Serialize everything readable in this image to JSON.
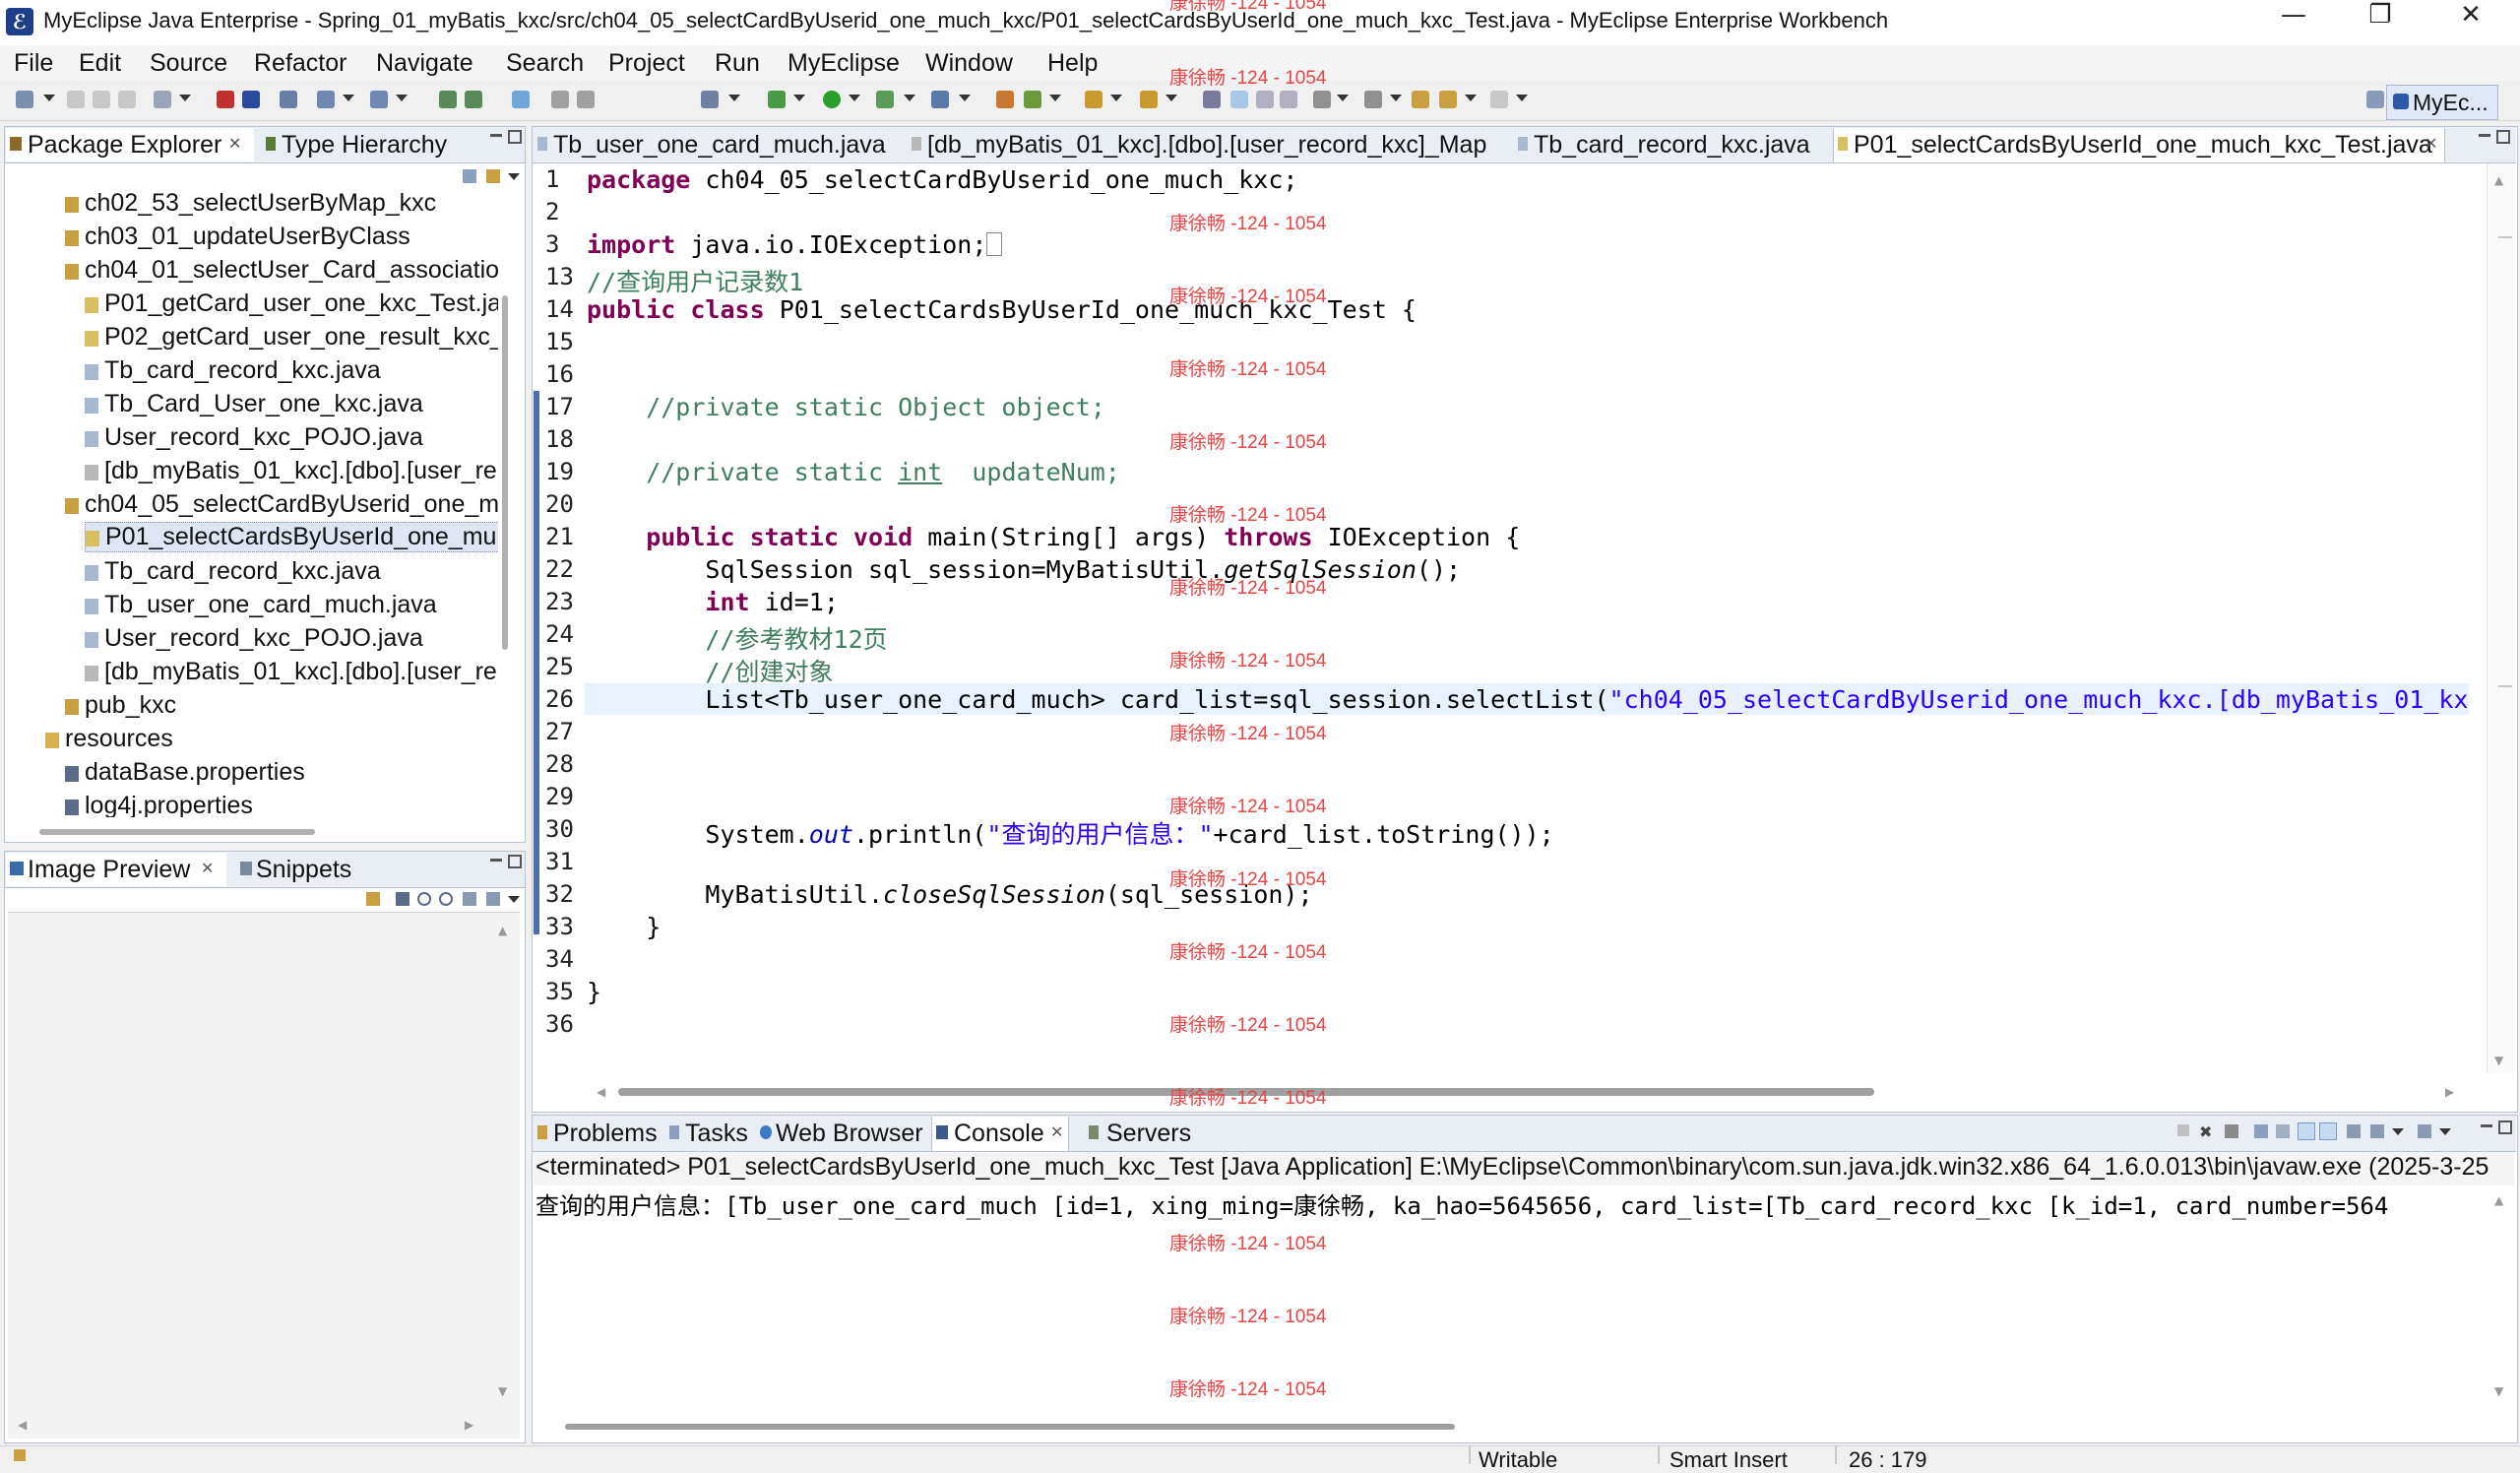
{
  "window": {
    "title": "MyEclipse Java Enterprise - Spring_01_myBatis_kxc/src/ch04_05_selectCardByUserid_one_much_kxc/P01_selectCardsByUserId_one_much_kxc_Test.java - MyEclipse Enterprise Workbench",
    "minimize": "—",
    "maximize": "❐",
    "close": "✕"
  },
  "menu": [
    "File",
    "Edit",
    "Source",
    "Refactor",
    "Navigate",
    "Search",
    "Project",
    "Run",
    "MyEclipse",
    "Window",
    "Help"
  ],
  "perspective": "MyEc...",
  "package_explorer": {
    "tab1": "Package Explorer",
    "tab2": "Type Hierarchy",
    "items": [
      "ch02_53_selectUserByMap_kxc",
      "ch03_01_updateUserByClass",
      "ch04_01_selectUser_Card_associatio",
      "P01_getCard_user_one_kxc_Test.ja",
      "P02_getCard_user_one_result_kxc_",
      "Tb_card_record_kxc.java",
      "Tb_Card_User_one_kxc.java",
      "User_record_kxc_POJO.java",
      "[db_myBatis_01_kxc].[dbo].[user_re",
      "ch04_05_selectCardByUserid_one_m",
      "P01_selectCardsByUserId_one_mu",
      "Tb_card_record_kxc.java",
      "Tb_user_one_card_much.java",
      "User_record_kxc_POJO.java",
      "[db_myBatis_01_kxc].[dbo].[user_re",
      "pub_kxc",
      "resources",
      "dataBase.properties",
      "log4j.properties"
    ]
  },
  "image_preview": {
    "tab1": "Image Preview",
    "tab2": "Snippets"
  },
  "editor": {
    "tabs": [
      "Tb_user_one_card_much.java",
      "[db_myBatis_01_kxc].[dbo].[user_record_kxc]_Map",
      "Tb_card_record_kxc.java",
      "P01_selectCardsByUserId_one_much_kxc_Test.java"
    ],
    "line_numbers": [
      "1",
      "2",
      "3",
      "13",
      "14",
      "15",
      "16",
      "17",
      "18",
      "19",
      "20",
      "21",
      "22",
      "23",
      "24",
      "25",
      "26",
      "27",
      "28",
      "29",
      "30",
      "31",
      "32",
      "33",
      "34",
      "35",
      "36"
    ],
    "lines": {
      "l1_kw": "package",
      "l1_rest": " ch04_05_selectCardByUserid_one_much_kxc;",
      "l3_kw": "import",
      "l3_rest": " java.io.IOException;",
      "l13": "//查询用户记录数1",
      "l14_kw1": "public",
      "l14_kw2": "class",
      "l14_rest": " P01_selectCardsByUserId_one_much_kxc_Test {",
      "l17": "    //private static Object object;",
      "l19_a": "    //private static ",
      "l19_b": "int",
      "l19_c": "  updateNum;",
      "l21_kw": "    public static void",
      "l21_mid": " main(String[] args) ",
      "l21_kw2": "throws",
      "l21_rest": " IOException {",
      "l22_a": "        SqlSession sql_session=MyBatisUtil.",
      "l22_b": "getSqlSession",
      "l22_c": "();",
      "l23_kw": "        int",
      "l23_rest": " id=1;",
      "l24": "        //参考教材12页",
      "l25": "        //创建对象",
      "l26_a": "        List<Tb_user_one_card_much> card_list=sql_session.selectList(",
      "l26_b": "\"ch04_05_selectCardByUserid_one_much_kxc.[db_myBatis_01_kxc",
      "l30_a": "        System.",
      "l30_b": "out",
      "l30_c": ".println(",
      "l30_d": "\"查询的用户信息：\"",
      "l30_e": "+card_list.toString());",
      "l32_a": "        MyBatisUtil.",
      "l32_b": "closeSqlSession",
      "l32_c": "(sql_session);",
      "l33": "    }",
      "l35": "}"
    }
  },
  "bottom_panel": {
    "tabs": [
      "Problems",
      "Tasks",
      "Web Browser",
      "Console",
      "Servers"
    ],
    "console_header": "<terminated> P01_selectCardsByUserId_one_much_kxc_Test [Java Application] E:\\MyEclipse\\Common\\binary\\com.sun.java.jdk.win32.x86_64_1.6.0.013\\bin\\javaw.exe (2025-3-25",
    "console_output": "查询的用户信息：[Tb_user_one_card_much [id=1, xing_ming=康徐畅, ka_hao=5645656, card_list=[Tb_card_record_kxc [k_id=1, card_number=564"
  },
  "watermark": "康徐畅 -124 - 1054",
  "status": {
    "writable": "Writable",
    "insert": "Smart Insert",
    "position": "26 : 179"
  }
}
